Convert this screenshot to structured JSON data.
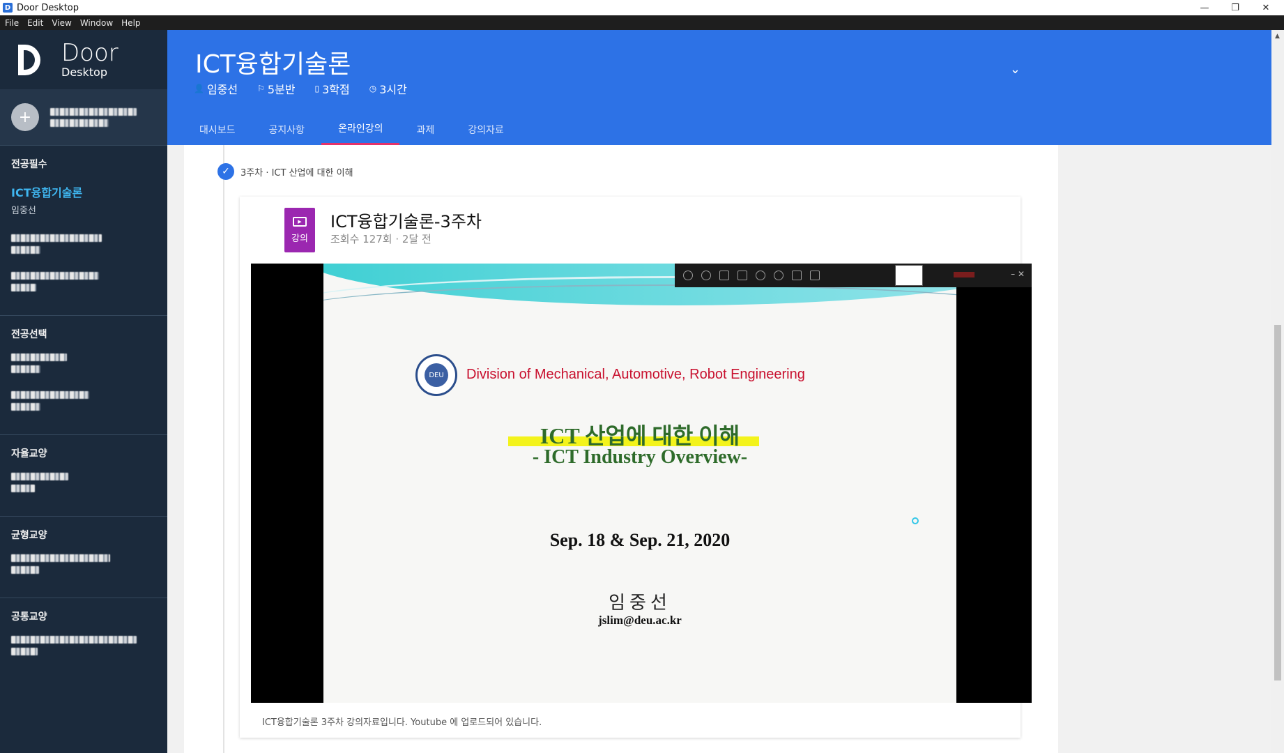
{
  "window": {
    "title": "Door Desktop",
    "min": "—",
    "max": "❐",
    "close": "✕"
  },
  "menu": [
    "File",
    "Edit",
    "View",
    "Window",
    "Help"
  ],
  "brand": {
    "name": "Door",
    "sub": "Desktop"
  },
  "sidebar": {
    "sections": [
      {
        "title": "전공필수",
        "current_course": {
          "name": "ICT융합기술론",
          "professor": "임중선"
        }
      },
      {
        "title": "전공선택"
      },
      {
        "title": "자율교양"
      },
      {
        "title": "균형교양"
      },
      {
        "title": "공통교양"
      }
    ]
  },
  "course": {
    "title": "ICT융합기술론",
    "professor": "임중선",
    "section": "5분반",
    "credits": "3학점",
    "hours": "3시간"
  },
  "tabs": [
    "대시보드",
    "공지사항",
    "온라인강의",
    "과제",
    "강의자료"
  ],
  "active_tab": "온라인강의",
  "week": {
    "label": "3주차 · ICT 산업에 대한 이해"
  },
  "lecture": {
    "badge": "강의",
    "title": "ICT융합기술론-3주차",
    "stats": "조회수 127회 · 2달 전",
    "description": "ICT융합기술론 3주차 강의자료입니다. Youtube 에 업로드되어 있습니다."
  },
  "slide": {
    "division": "Division of Mechanical, Automotive, Robot Engineering",
    "kor_title": "ICT 산업에 대한 이해",
    "eng_title": "- ICT Industry Overview-",
    "date": "Sep. 18 & Sep. 21, 2020",
    "author": "임중선",
    "email": "jslim@deu.ac.kr"
  },
  "colors": {
    "header": "#2d72e6",
    "sidebar": "#1b2a3c",
    "active_tab_underline": "#e4326a",
    "badge": "#9b27b0"
  }
}
